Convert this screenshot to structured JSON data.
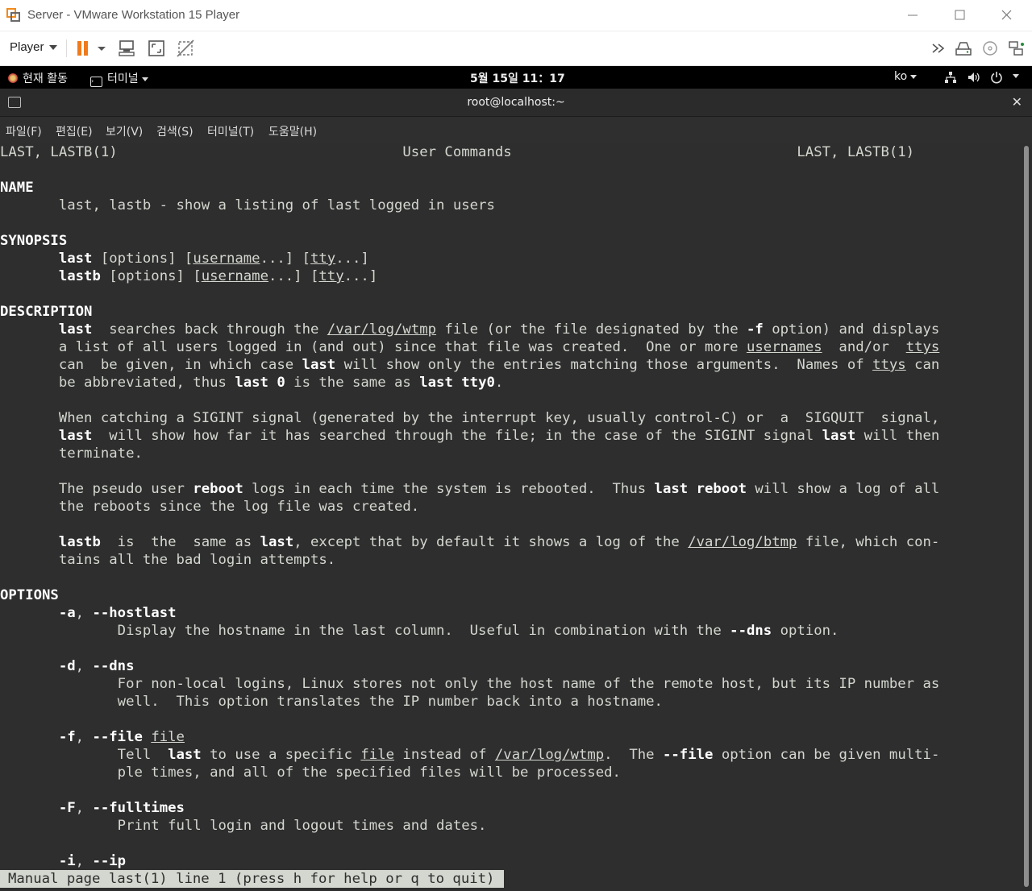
{
  "window": {
    "title": "Server - VMware Workstation 15 Player",
    "player_menu": "Player",
    "toolbar_icons": [
      "pause-icon",
      "send-ctrl-alt-del-icon",
      "fit-guest-icon",
      "unity-icon"
    ],
    "right_icons": [
      "more-icon",
      "removable-device-icon",
      "cd-icon",
      "network-adapter-icon"
    ]
  },
  "gnome": {
    "activities": "현재 활동",
    "app_menu": "터미널",
    "clock": "5월 15일  11：17",
    "lang": "ko"
  },
  "terminal": {
    "title": "root@localhost:~",
    "menu": [
      "파일(F)",
      "편집(E)",
      "보기(V)",
      "검색(S)",
      "터미널(T)",
      "도움말(H)"
    ],
    "lines": [
      "LAST, LASTB(1)                                  User Commands                                  LAST, LASTB(1)",
      "",
      "NAME",
      "       last, lastb - show a listing of last logged in users",
      "",
      "SYNOPSIS",
      "       last [options] [username...] [tty...]",
      "       lastb [options] [username...] [tty...]",
      "",
      "DESCRIPTION",
      "       last  searches back through the /var/log/wtmp file (or the file designated by the -f option) and displays",
      "       a list of all users logged in (and out) since that file was created.  One or more usernames  and/or  ttys",
      "       can  be given, in which case last will show only the entries matching those arguments.  Names of ttys can",
      "       be abbreviated, thus last 0 is the same as last tty0.",
      "",
      "       When catching a SIGINT signal (generated by the interrupt key, usually control-C) or  a  SIGQUIT  signal,",
      "       last  will show how far it has searched through the file; in the case of the SIGINT signal last will then",
      "       terminate.",
      "",
      "       The pseudo user reboot logs in each time the system is rebooted.  Thus last reboot will show a log of all",
      "       the reboots since the log file was created.",
      "",
      "       lastb  is  the  same as last, except that by default it shows a log of the /var/log/btmp file, which con‐",
      "       tains all the bad login attempts.",
      "",
      "OPTIONS",
      "       -a, --hostlast",
      "              Display the hostname in the last column.  Useful in combination with the --dns option.",
      "",
      "       -d, --dns",
      "              For non-local logins, Linux stores not only the host name of the remote host, but its IP number as",
      "              well.  This option translates the IP number back into a hostname.",
      "",
      "       -f, --file file",
      "              Tell  last to use a specific file instead of /var/log/wtmp.  The --file option can be given multi‐",
      "              ple times, and all of the specified files will be processed.",
      "",
      "       -F, --fulltimes",
      "              Print full login and logout times and dates.",
      "",
      "       -i, --ip"
    ],
    "status": "Manual page last(1) line 1 (press h for help or q to quit)"
  }
}
